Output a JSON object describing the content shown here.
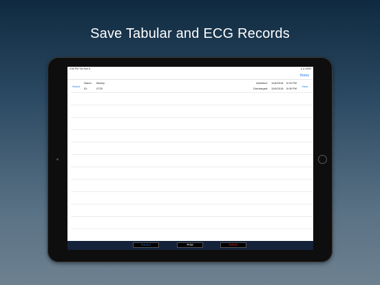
{
  "headline": "Save Tabular and ECG Records",
  "statusbar": {
    "time": "9:56 PM   Thu Nov 8",
    "right": "▸ ● 100%"
  },
  "nav": {
    "home_label": "Home"
  },
  "record": {
    "select_label": "Select",
    "name_label": "Name:",
    "name_value": "Marley",
    "id_label": "ID:",
    "id_value": "0725",
    "admitted_label": "Admitted:",
    "admitted_value": "11/8/2018",
    "admitted_time": "5:03 PM",
    "discharged_label": "Discharged:",
    "discharged_value": "11/8/2018",
    "discharged_time": "5:08 PM",
    "view_label": "View"
  },
  "toolbar": {
    "extract_label": "Extract",
    "print_label": "Print",
    "delete_label": "Delete"
  },
  "colors": {
    "link_blue": "#1a74e8",
    "extract_text": "#2b63b8",
    "print_text": "#ffffff",
    "delete_text": "#d42020",
    "toolbar_bg": "#14223a"
  }
}
